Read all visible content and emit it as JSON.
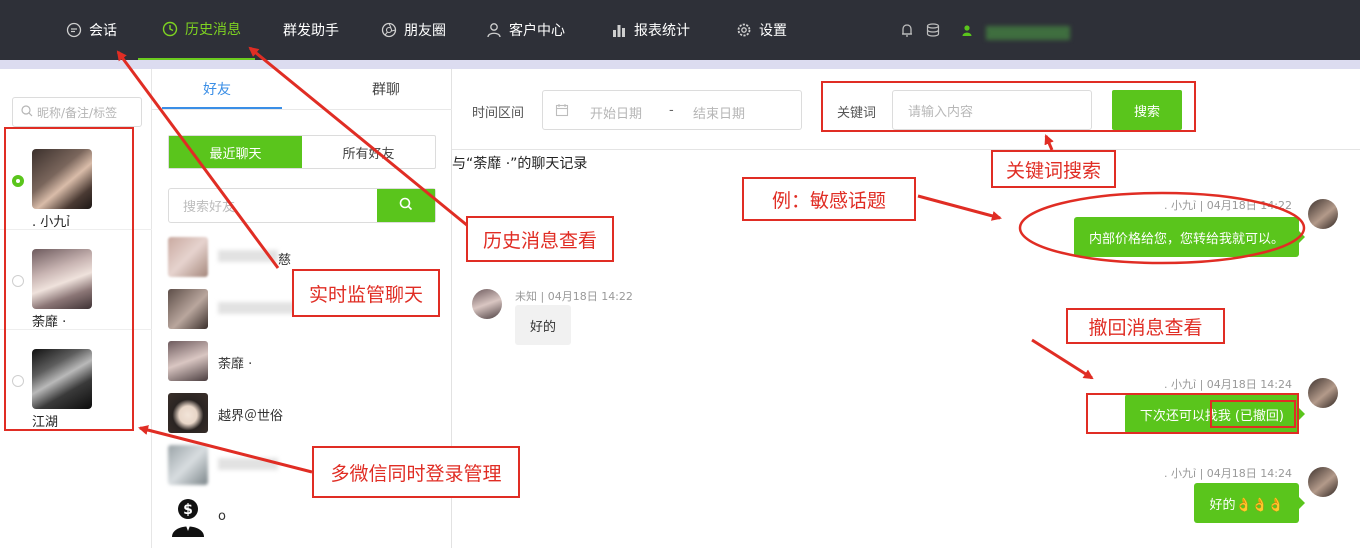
{
  "nav": {
    "items": [
      {
        "label": "会话",
        "icon": "chat-icon"
      },
      {
        "label": "历史消息",
        "icon": "clock-icon",
        "active": true
      },
      {
        "label": "群发助手"
      },
      {
        "label": "朋友圈",
        "icon": "aperture-icon"
      },
      {
        "label": "客户中心",
        "icon": "user-icon"
      },
      {
        "label": "报表统计",
        "icon": "bar-chart-icon"
      },
      {
        "label": "设置",
        "icon": "gear-icon"
      }
    ],
    "right_icons": [
      "bell-icon",
      "database-icon",
      "user-icon"
    ],
    "accent": "#7ed321"
  },
  "accounts": {
    "search_placeholder": "昵称/备注/标签",
    "items": [
      {
        "name": ". 小九ỉ",
        "selected": true
      },
      {
        "name": "荼靡 ·",
        "selected": false
      },
      {
        "name": "江湖",
        "selected": false
      }
    ]
  },
  "friends": {
    "tabs": [
      "好友",
      "群聊"
    ],
    "segments": [
      "最近聊天",
      "所有好友"
    ],
    "search_placeholder": "搜索好友",
    "items": [
      {
        "name": "慈"
      },
      {
        "name": ""
      },
      {
        "name": "荼靡 ·"
      },
      {
        "name": "越界＠世俗"
      },
      {
        "name": ""
      },
      {
        "name": "o"
      }
    ]
  },
  "chat": {
    "filter": {
      "time_label": "时间区间",
      "start_placeholder": "开始日期",
      "dash": "-",
      "end_placeholder": "结束日期",
      "keyword_label": "关键词",
      "keyword_placeholder": "请输入内容",
      "search_button": "搜索"
    },
    "header": "与“荼靡 ·”的聊天记录",
    "messages": [
      {
        "meta": ". 小九ỉ | 04月18日 14:22",
        "text": "内部价格给您，您转给我就可以。",
        "from": "me"
      },
      {
        "meta": "未知 | 04月18日 14:22",
        "text": "好的",
        "from": "other"
      },
      {
        "meta": ". 小九ỉ | 04月18日 14:24",
        "text": "下次还可以找我",
        "recall_tag": "(已撤回)",
        "from": "me"
      },
      {
        "meta": ". 小九ỉ | 04月18日 14:24",
        "text": "好的👌👌👌",
        "from": "me"
      }
    ]
  },
  "annotations": {
    "history_view": "历史消息查看",
    "realtime_monitor": "实时监管聊天",
    "multi_login": "多微信同时登录管理",
    "keyword_search": "关键词搜索",
    "sensitive_example": "例：敏感话题",
    "recall_view": "撤回消息查看",
    "color": "#e02d24"
  },
  "colors": {
    "green": "#5ac51c",
    "topbar": "#2e3038"
  }
}
